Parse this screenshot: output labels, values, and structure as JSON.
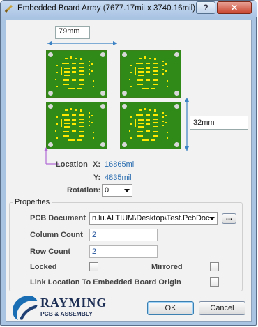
{
  "window": {
    "title": "Embedded Board Array (7677.17mil x 3740.16mil) [mil]",
    "help_glyph": "?",
    "close_glyph": "✕"
  },
  "preview": {
    "width_label": "79mm",
    "height_label": "32mm",
    "location_label": "Location",
    "x_label": "X:",
    "x_value": "16865mil",
    "y_label": "Y:",
    "y_value": "4835mil"
  },
  "rotation": {
    "label": "Rotation:",
    "value": "0"
  },
  "properties": {
    "title": "Properties",
    "pcb_document_label": "PCB Document",
    "pcb_document_value": "n.lu.ALTIUM\\Desktop\\Test.PcbDoc",
    "browse_label": "...",
    "column_count_label": "Column Count",
    "column_count_value": "2",
    "row_count_label": "Row Count",
    "row_count_value": "2",
    "locked_label": "Locked",
    "mirrored_label": "Mirrored",
    "link_label": "Link Location To Embedded Board Origin",
    "locked": false,
    "mirrored": false,
    "link": false
  },
  "logo": {
    "name": "RAYMING",
    "sub": "PCB & ASSEMBLY"
  },
  "buttons": {
    "ok": "OK",
    "cancel": "Cancel"
  },
  "colors": {
    "board": "#2f8a17",
    "silk": "#ffe800",
    "dimension": "#3b82c4",
    "origin": "#b36bd6"
  }
}
